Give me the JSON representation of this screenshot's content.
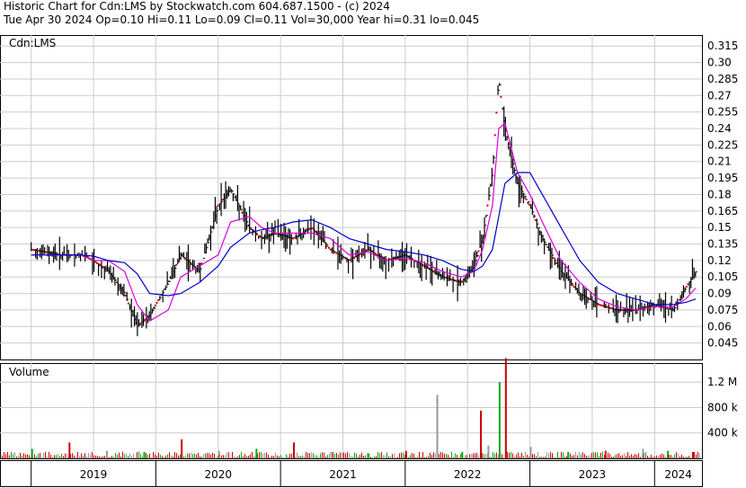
{
  "header": {
    "line1": "Historic Chart for Cdn:LMS by Stockwatch.com 604.687.1500 - (c) 2024",
    "line2": "Tue Apr 30 2024  Op=0.10  Hi=0.11  Lo=0.09  Cl=0.11  Vol=30,000  Year hi=0.31  lo=0.045"
  },
  "chart_data": [
    {
      "type": "line",
      "title": "Cdn:LMS",
      "ylim": [
        0.03,
        0.325
      ],
      "yticks": [
        "0.315",
        "0.30",
        "0.285",
        "0.27",
        "0.255",
        "0.24",
        "0.225",
        "0.21",
        "0.195",
        "0.18",
        "0.165",
        "0.15",
        "0.135",
        "0.12",
        "0.105",
        "0.09",
        "0.075",
        "0.06",
        "0.045"
      ],
      "x": [
        2019.0,
        2019.25,
        2019.4,
        2019.5,
        2019.62,
        2019.75,
        2019.85,
        2019.95,
        2020.1,
        2020.2,
        2020.35,
        2020.5,
        2020.6,
        2020.75,
        2020.85,
        2020.95,
        2021.1,
        2021.25,
        2021.4,
        2021.55,
        2021.7,
        2021.85,
        2022.0,
        2022.15,
        2022.3,
        2022.45,
        2022.55,
        2022.62,
        2022.7,
        2022.75,
        2022.8,
        2022.9,
        2023.0,
        2023.1,
        2023.25,
        2023.4,
        2023.55,
        2023.7,
        2023.85,
        2024.0,
        2024.15,
        2024.25,
        2024.33
      ],
      "series": [
        {
          "values": [
            0.13,
            0.125,
            0.125,
            0.12,
            0.11,
            0.09,
            0.06,
            0.07,
            0.1,
            0.125,
            0.11,
            0.17,
            0.185,
            0.15,
            0.14,
            0.145,
            0.14,
            0.15,
            0.13,
            0.12,
            0.13,
            0.12,
            0.125,
            0.115,
            0.105,
            0.1,
            0.115,
            0.14,
            0.2,
            0.285,
            0.24,
            0.19,
            0.17,
            0.14,
            0.11,
            0.09,
            0.08,
            0.075,
            0.075,
            0.08,
            0.075,
            0.095,
            0.11
          ]
        },
        {
          "values": [
            0.125,
            0.125,
            0.125,
            0.12,
            0.12,
            0.11,
            0.08,
            0.065,
            0.075,
            0.105,
            0.115,
            0.125,
            0.155,
            0.16,
            0.15,
            0.145,
            0.145,
            0.145,
            0.14,
            0.125,
            0.128,
            0.12,
            0.122,
            0.118,
            0.11,
            0.105,
            0.11,
            0.13,
            0.17,
            0.24,
            0.245,
            0.2,
            0.18,
            0.155,
            0.12,
            0.1,
            0.085,
            0.078,
            0.075,
            0.078,
            0.078,
            0.085,
            0.095
          ]
        },
        {
          "values": [
            0.125,
            0.125,
            0.125,
            0.124,
            0.12,
            0.118,
            0.108,
            0.09,
            0.088,
            0.09,
            0.1,
            0.115,
            0.132,
            0.145,
            0.148,
            0.15,
            0.155,
            0.157,
            0.15,
            0.14,
            0.135,
            0.13,
            0.128,
            0.125,
            0.12,
            0.112,
            0.11,
            0.115,
            0.13,
            0.16,
            0.19,
            0.2,
            0.2,
            0.18,
            0.15,
            0.12,
            0.1,
            0.09,
            0.085,
            0.08,
            0.08,
            0.082,
            0.085
          ]
        }
      ]
    },
    {
      "type": "bar",
      "title": "Volume",
      "ylim": [
        0,
        1500000
      ],
      "yticks": [
        "1.2 M",
        "800 k",
        "400 k"
      ],
      "x": [
        2019.0,
        2019.3,
        2019.6,
        2019.9,
        2020.2,
        2020.5,
        2020.8,
        2021.1,
        2021.4,
        2021.7,
        2022.0,
        2022.25,
        2022.45,
        2022.6,
        2022.66,
        2022.75,
        2022.8,
        2023.0,
        2023.3,
        2023.6,
        2023.9,
        2024.1,
        2024.3
      ],
      "values": [
        150000,
        250000,
        120000,
        100000,
        300000,
        120000,
        150000,
        250000,
        100000,
        80000,
        120000,
        1000000,
        100000,
        750000,
        200000,
        1200000,
        1580000,
        180000,
        100000,
        120000,
        150000,
        120000,
        100000
      ]
    }
  ],
  "x_axis": {
    "labels": [
      "2019",
      "2020",
      "2021",
      "2022",
      "2023",
      "2024"
    ]
  },
  "colors": {
    "price_bars": "#000000",
    "down_marks": "#cc0000",
    "ma_short": "#dd00dd",
    "ma_long": "#0000cc",
    "volume_up": "#00aa00",
    "volume_down": "#cc0000",
    "volume_neutral": "#999999",
    "grid": "#cccccc"
  }
}
